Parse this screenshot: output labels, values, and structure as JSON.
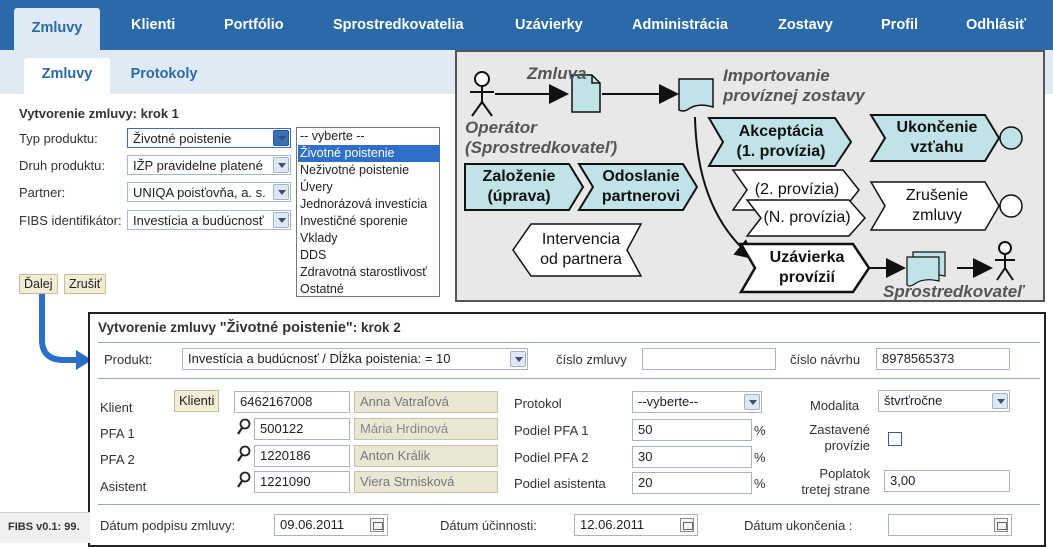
{
  "nav": {
    "items": [
      "Zmluvy",
      "Klienti",
      "Portfólio",
      "Sprostredkovatelia",
      "Uzávierky",
      "Administrácia",
      "Zostavy",
      "Profil",
      "Odhlásiť"
    ]
  },
  "subnav": {
    "tabs": [
      "Zmluvy",
      "Protokoly"
    ]
  },
  "step1": {
    "title": "Vytvorenie zmluvy: krok 1",
    "labels": [
      "Typ produktu:",
      "Druh produktu:",
      "Partner:",
      "FIBS identifikátor:"
    ],
    "values": [
      "Životné poistenie",
      "IŽP pravidelne platené",
      "UNIQA poisťovňa, a. s.",
      "Investícia a budúcnosť"
    ],
    "buttons": {
      "next": "Ďalej",
      "cancel": "Zrušiť"
    }
  },
  "dropdown": {
    "options": [
      "-- vyberte --",
      "Životné poistenie",
      "Neživotné poistenie",
      "Úvery",
      "Jednorázová investícia",
      "Investičné sporenie",
      "Vklady",
      "DDS",
      "Zdravotná starostlivosť",
      "Ostatné"
    ],
    "selected_index": 1
  },
  "diagram": {
    "operator": [
      "Operátor",
      "(Sprostredkovateľ)"
    ],
    "zmluva": "Zmluva",
    "import": [
      "Importovanie",
      "províznej zostavy"
    ],
    "zalozenie": [
      "Založenie",
      "(úprava)"
    ],
    "odoslanie": [
      "Odoslanie",
      "partnerovi"
    ],
    "akceptacia": [
      "Akceptácia",
      "(1. provízia)"
    ],
    "provizia2": "(2. provízia)",
    "provizian": "(N. provízia)",
    "ukoncenie": [
      "Ukončenie",
      "vzťahu"
    ],
    "zrusenie": [
      "Zrušenie",
      "zmluvy"
    ],
    "intervencia": [
      "Intervencia",
      "od partnera"
    ],
    "uzavierka": [
      "Uzávierka",
      "provízií"
    ],
    "sprostredkovatel": "Sprostredkovateľ"
  },
  "step2": {
    "title_prefix": "Vytvorenie zmluvy ",
    "title_product": "\"Životné poistenie\"",
    "title_suffix": ": krok 2",
    "produkt_label": "Produkt:",
    "produkt_value": "Investícia a budúcnosť / Dĺžka poistenia: = 10",
    "cislo_zmluvy_label": "číslo zmluvy",
    "cislo_zmluvy_value": "",
    "cislo_navrhu_label": "číslo návrhu",
    "cislo_navrhu_value": "8978565373",
    "klient_label": "Klient",
    "klienti_button": "Klienti",
    "klient_id": "6462167008",
    "klient_name": "Anna Vatraľová",
    "pfa1_label": "PFA 1",
    "pfa1_id": "500122",
    "pfa1_name": "Mária Hrdinová",
    "pfa2_label": "PFA 2",
    "pfa2_id": "1220186",
    "pfa2_name": "Anton Králik",
    "asistent_label": "Asistent",
    "asistent_id": "1221090",
    "asistent_name": "Viera Strnisková",
    "protokol_label": "Protokol",
    "protokol_value": "--vyberte--",
    "podiel_pfa1_label": "Podiel PFA 1",
    "podiel_pfa1_value": "50",
    "podiel_pfa2_label": "Podiel PFA 2",
    "podiel_pfa2_value": "30",
    "podiel_asistenta_label": "Podiel asistenta",
    "podiel_asistenta_value": "20",
    "percent": "%",
    "modalita_label": "Modalita",
    "modalita_value": "štvrťročne",
    "zastavene_label": [
      "Zastavené",
      "provízie"
    ],
    "poplatok_label": [
      "Poplatok",
      "tretej strane"
    ],
    "poplatok_value": "3,00",
    "datum_podpisu_label": "Dátum podpisu zmluvy:",
    "datum_podpisu_value": "09.06.2011",
    "datum_ucinnosti_label": "Dátum účinnosti:",
    "datum_ucinnosti_value": "12.06.2011",
    "datum_ukoncenia_label": "Dátum ukončenia  :",
    "datum_ukoncenia_value": ""
  },
  "footer": {
    "version": "FIBS v0.1: 99."
  },
  "colors": {
    "nav": "#2a6aa8",
    "subnav": "#dfeaf5",
    "shape_fill": "#bfe3e6",
    "selected": "#2f6fc8"
  }
}
